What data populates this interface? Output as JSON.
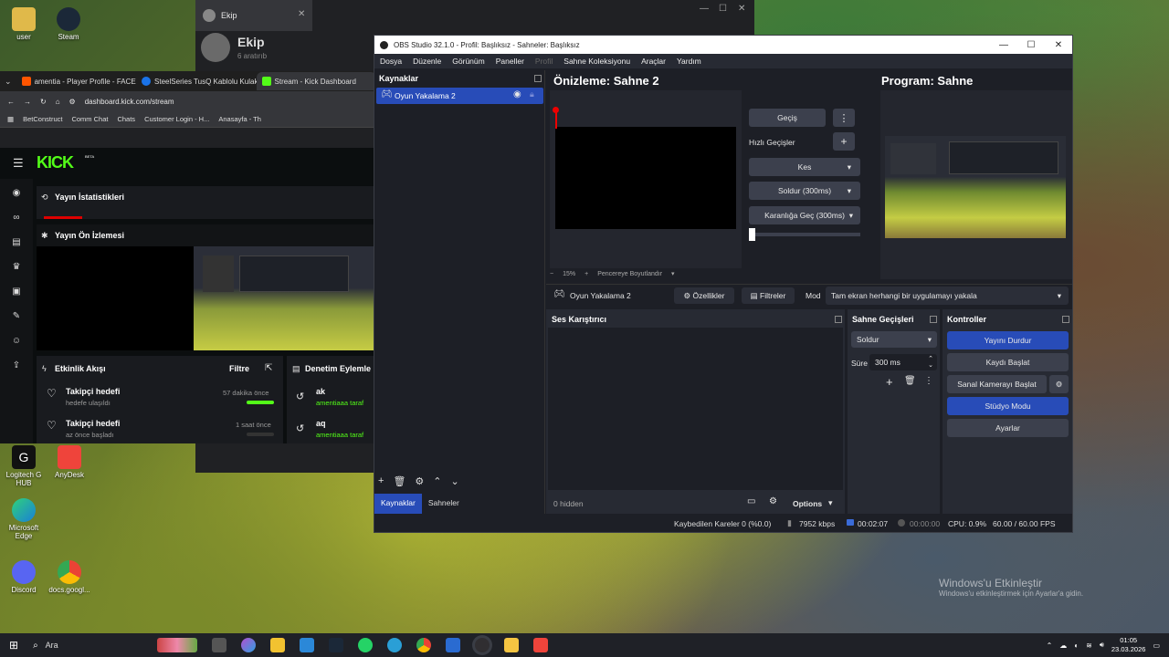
{
  "colors": {
    "obs_accent": "#284cb8",
    "kick_green": "#53fc18",
    "obs_bg": "#1d1f26",
    "obs_panel": "#272a33"
  },
  "desktop": {
    "icons": [
      {
        "label": "user",
        "icon": "user-folder-icon"
      },
      {
        "label": "Steam",
        "icon": "steam-icon"
      },
      {
        "label": "Logitech G HUB",
        "icon": "logitech-icon"
      },
      {
        "label": "AnyDesk",
        "icon": "anydesk-icon"
      },
      {
        "label": "Microsoft Edge",
        "icon": "edge-icon"
      },
      {
        "label": "Discord",
        "icon": "discord-icon"
      },
      {
        "label": "docs.googl...",
        "icon": "chrome-icon"
      }
    ],
    "watermark_line1": "Windows'u Etkinleştir",
    "watermark_line2": "Windows'u etkinleştirmek için Ayarlar'a gidin."
  },
  "ekip": {
    "tab_title": "Ekip",
    "name": "Ekip",
    "sub": "6 aratırıb"
  },
  "browser": {
    "tabs": [
      "amentia - Player Profile - FACEIT",
      "SteelSeries TusQ Kablolu Kulaklık",
      "Stream - Kick Dashboard"
    ],
    "url": "dashboard.kick.com/stream",
    "bookmarks": [
      "BetConstruct",
      "Comm Chat",
      "Chats",
      "Customer Login - H...",
      "Anasayfa - Th"
    ],
    "kick": {
      "logo": "KICK",
      "logo_badge": "BETA",
      "stats_title": "Yayın İstatistikleri",
      "preview_title": "Yayın Ön İzlemesi",
      "activity_title": "Etkinlik Akışı",
      "filter_label": "Filtre",
      "activities": [
        {
          "title": "Takipçi hedefi",
          "sub": "hedefe ulaşıldı",
          "time": "57 dakika önce"
        },
        {
          "title": "Takipçi hedefi",
          "sub": "az önce başladı",
          "time": "1 saat önce"
        }
      ],
      "mod_title": "Denetim Eylemle",
      "mod_items": [
        {
          "title": "ak",
          "sub": "amentiaaa taraf"
        },
        {
          "title": "aq",
          "sub": "amentiaaa taraf"
        }
      ]
    }
  },
  "obs": {
    "title": "OBS Studio 32.1.0 - Profil: Başlıksız - Sahneler: Başlıksız",
    "menu": [
      "Dosya",
      "Düzenle",
      "Görünüm",
      "Paneller",
      "Profil",
      "Sahne Koleksiyonu",
      "Araçlar",
      "Yardım"
    ],
    "sources_title": "Kaynaklar",
    "source_item": "Oyun Yakalama 2",
    "preview_title": "Önizleme: Sahne 2",
    "program_title": "Program: Sahne",
    "zoom": "15%",
    "fit_label": "Pencereye Boyutlandır",
    "transition_btn": "Geçiş",
    "quick_transitions": "Hızlı Geçişler",
    "quick_items": [
      "Kes",
      "Soldur (300ms)",
      "Karanlığa Geç (300ms)"
    ],
    "source_bar_name": "Oyun Yakalama 2",
    "properties_btn": "Özellikler",
    "filters_btn": "Filtreler",
    "mode_label": "Mod",
    "mode_value": "Tam ekran herhangi bir uygulamayı yakala",
    "mixer_title": "Ses Karıştırıcı",
    "transitions_title": "Sahne Geçişleri",
    "transition_value": "Soldur",
    "duration_label": "Süre",
    "duration_value": "300 ms",
    "controls_title": "Kontroller",
    "controls": [
      "Yayını Durdur",
      "Kaydı Başlat",
      "Sanal Kamerayı Başlat",
      "Stüdyo Modu",
      "Ayarlar"
    ],
    "tabs": [
      "Kaynaklar",
      "Sahneler"
    ],
    "hidden_count": "0 hidden",
    "options_label": "Options",
    "status": {
      "dropped": "Kaybedilen Kareler 0 (%0.0)",
      "bitrate": "7952 kbps",
      "stream_time": "00:02:07",
      "rec_time": "00:00:00",
      "cpu": "CPU: 0.9%",
      "fps": "60.00 / 60.00 FPS"
    }
  },
  "taskbar": {
    "search": "Ara",
    "time": "01:05",
    "date": "23.03.2026"
  }
}
